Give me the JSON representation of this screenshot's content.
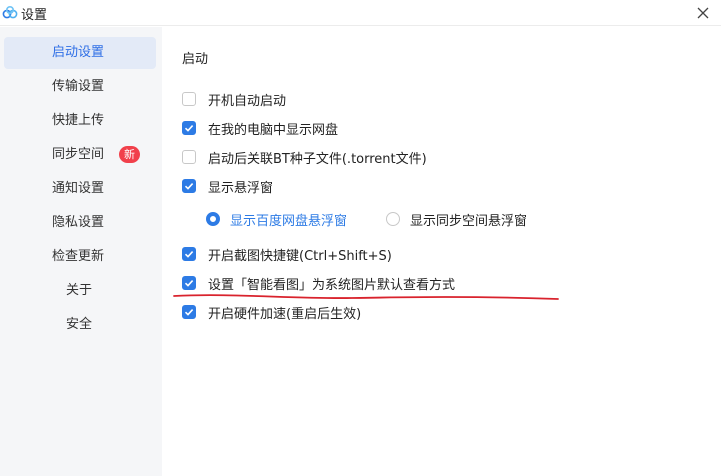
{
  "window": {
    "title": "设置",
    "close_icon": "close-icon",
    "app_icon": "cloud-logo-icon"
  },
  "sidebar": {
    "items": [
      {
        "label": "启动设置",
        "active": true
      },
      {
        "label": "传输设置"
      },
      {
        "label": "快捷上传"
      },
      {
        "label": "同步空间",
        "badge": "新"
      },
      {
        "label": "通知设置"
      },
      {
        "label": "隐私设置"
      },
      {
        "label": "检查更新"
      },
      {
        "label": "关于"
      },
      {
        "label": "安全"
      }
    ]
  },
  "main": {
    "section_title": "启动",
    "options": [
      {
        "label": "开机自动启动",
        "checked": false
      },
      {
        "label": "在我的电脑中显示网盘",
        "checked": true
      },
      {
        "label": "启动后关联BT种子文件(.torrent文件)",
        "checked": false
      },
      {
        "label": "显示悬浮窗",
        "checked": true
      },
      {
        "label": "开启截图快捷键(Ctrl+Shift+S)",
        "checked": true
      },
      {
        "label": "设置「智能看图」为系统图片默认查看方式",
        "checked": true
      },
      {
        "label": "开启硬件加速(重启后生效)",
        "checked": true
      }
    ],
    "float_window_radios": [
      {
        "label": "显示百度网盘悬浮窗",
        "selected": true
      },
      {
        "label": "显示同步空间悬浮窗",
        "selected": false
      }
    ]
  },
  "colors": {
    "accent": "#2d7be5",
    "badge": "#f1404b",
    "annotation": "#d9232d",
    "sidebar_bg": "#f5f6f8",
    "active_bg": "#e3eaf7"
  }
}
